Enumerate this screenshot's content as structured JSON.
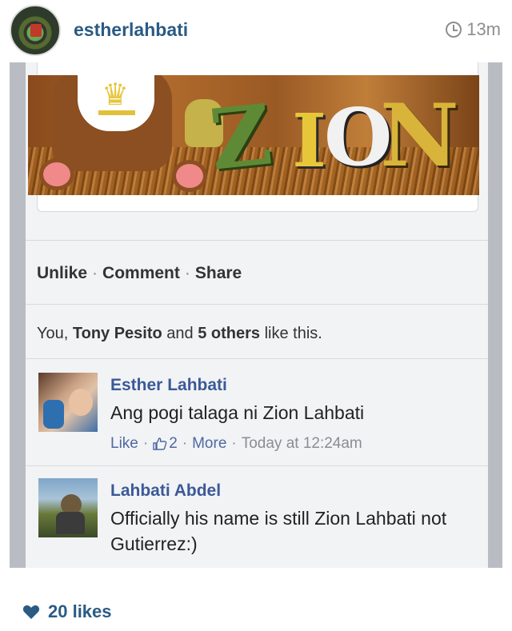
{
  "post": {
    "username": "estherlahbati",
    "time_ago": "13m",
    "likes_count": "20 likes"
  },
  "facebook": {
    "actions": {
      "unlike": "Unlike",
      "comment": "Comment",
      "share": "Share",
      "separator": "·"
    },
    "likes_summary": {
      "prefix": "You, ",
      "name": "Tony Pesito",
      "middle": " and ",
      "others": "5 others",
      "suffix": " like this."
    },
    "comments": [
      {
        "author": "Esther Lahbati",
        "text": "Ang pogi talaga ni Zion Lahbati",
        "like_label": "Like",
        "like_count": "2",
        "more_label": "More",
        "timestamp": "Today at 12:24am"
      },
      {
        "author": "Lahbati Abdel",
        "text": "Officially his name is still Zion Lahbati not Gutierrez:)"
      }
    ]
  },
  "colors": {
    "username": "#2a5b84",
    "fb_link": "#3b5998",
    "meta_gray": "#8a8d91"
  }
}
